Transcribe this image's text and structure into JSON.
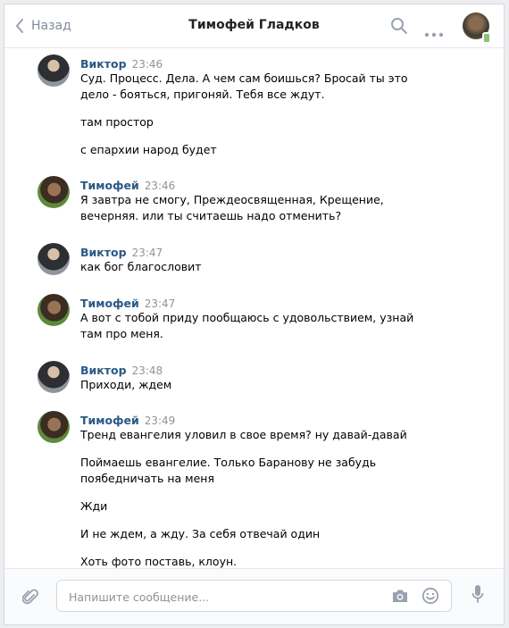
{
  "header": {
    "back_label": "Назад",
    "title": "Тимофей Гладков"
  },
  "messages": [
    {
      "author": "Виктор",
      "time": "23:46",
      "lines": [
        "Суд. Процесс. Дела. А чем сам боишься? Бросай ты это дело - бояться, пригоняй. Тебя все ждут.",
        "там простор",
        "с епархии народ будет"
      ]
    },
    {
      "author": "Тимофей",
      "time": "23:46",
      "lines": [
        "Я завтра не смогу, Преждеосвященная, Крещение, вечерняя. или ты считаешь надо отменить?"
      ]
    },
    {
      "author": "Виктор",
      "time": "23:47",
      "lines": [
        "как бог благословит"
      ]
    },
    {
      "author": "Тимофей",
      "time": "23:47",
      "lines": [
        "А вот с тобой приду пообщаюсь с удовольствием, узнай там про меня."
      ]
    },
    {
      "author": "Виктор",
      "time": "23:48",
      "lines": [
        "Приходи, ждем"
      ]
    },
    {
      "author": "Тимофей",
      "time": "23:49",
      "lines": [
        "Тренд евангелия уловил в свое время? ну давай-давай",
        "Поймаешь евангелие. Только Баранову не забудь поябедничать на меня",
        "Жди",
        "И не ждем, а жду. За себя отвечай один",
        "Хоть фото поставь, клоун."
      ]
    }
  ],
  "composer": {
    "placeholder": "Напишите сообщение..."
  },
  "icons": {
    "back": "chevron-left-icon",
    "search": "search-icon",
    "more": "more-dots-icon",
    "attach": "paperclip-icon",
    "camera": "camera-icon",
    "emoji": "smile-icon",
    "mic": "microphone-icon"
  },
  "colors": {
    "author_name": "#2a5885",
    "timestamp": "#939393",
    "online": "#8ac176"
  }
}
